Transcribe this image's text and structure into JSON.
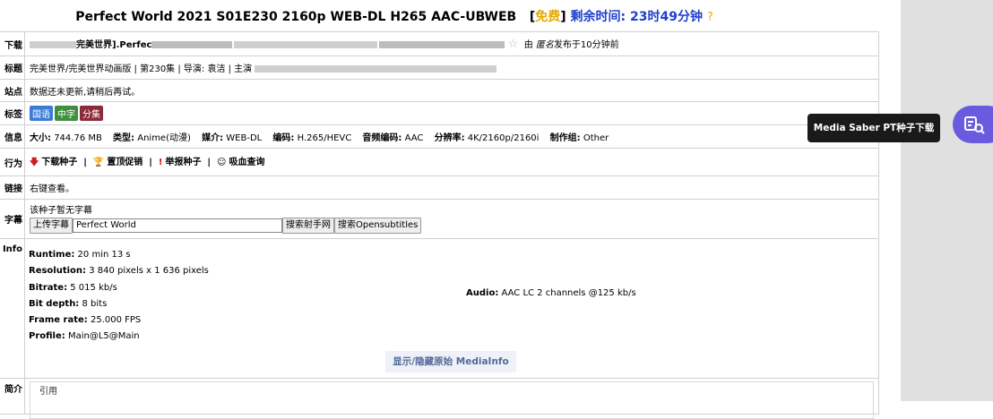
{
  "title": {
    "name": "Perfect World 2021 S01E230 2160p WEB-DL H265 AAC-UBWEB",
    "free_label": "免费",
    "remaining_label": "剩余时间:",
    "remaining_value": "23时49分钟",
    "help": "?"
  },
  "rows": {
    "download": {
      "label": "下载",
      "text_a": "完美世界].Perfec",
      "uploader_prefix": "由",
      "uploader_name": "匿名",
      "uploaded_suffix": "发布于10分钟前"
    },
    "subtitle_title": {
      "label": "标题",
      "text": "完美世界/完美世界动画版 | 第230集 | 导演: 袁洁 | 主演"
    },
    "site": {
      "label": "站点",
      "text": "数据还未更新,请稍后再试。"
    },
    "tags": {
      "label": "标签",
      "items": [
        "国语",
        "中字",
        "分集"
      ]
    },
    "info": {
      "label": "信息",
      "size_label": "大小:",
      "size": "744.76 MB",
      "type_label": "类型:",
      "type": "Anime(动漫)",
      "medium_label": "媒介:",
      "medium": "WEB-DL",
      "codec_label": "编码:",
      "codec": "H.265/HEVC",
      "audio_label": "音频编码:",
      "audio": "AAC",
      "res_label": "分辨率:",
      "res": "4K/2160p/2160i",
      "group_label": "制作组:",
      "group": "Other"
    },
    "actions": {
      "label": "行为",
      "download": "下载种子",
      "promote": "置顶促销",
      "report": "举报种子",
      "vampire": "吸血查询"
    },
    "link": {
      "label": "链接",
      "text": "右键查看。"
    },
    "subs": {
      "label": "字幕",
      "none_text": "该种子暂无字幕",
      "upload_btn": "上传字幕",
      "search_value": "Perfect World",
      "shooter_btn": "搜索射手网",
      "opensub_btn": "搜索Opensubtitles"
    },
    "mediainfo": {
      "label": "Info",
      "runtime_label": "Runtime:",
      "runtime": "20 min 13 s",
      "resolution_label": "Resolution:",
      "resolution": "3 840 pixels x 1 636 pixels",
      "bitrate_label": "Bitrate:",
      "bitrate": "5 015 kb/s",
      "bitdepth_label": "Bit depth:",
      "bitdepth": "8 bits",
      "framerate_label": "Frame rate:",
      "framerate": "25.000 FPS",
      "profile_label": "Profile:",
      "profile": "Main@L5@Main",
      "audio_label": "Audio:",
      "audio": "AAC LC 2 channels @125 kb/s",
      "toggle": "显示/隐藏原始 MediaInfo"
    },
    "intro": {
      "label": "简介",
      "quote": "引用"
    }
  },
  "extension": {
    "tooltip": "Media Saber PT种子下载"
  },
  "colors": {
    "free": "#e6a800",
    "remaining": "#1f3fcc",
    "fab": "#6a5ae0",
    "tag_blue": "#3b7bd5",
    "tag_green": "#3f8f3f",
    "tag_red": "#8a2a3a"
  }
}
